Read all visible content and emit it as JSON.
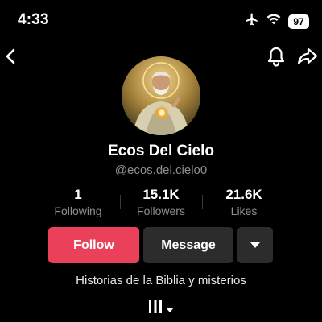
{
  "status_bar": {
    "time": "4:33",
    "battery": "97",
    "icons": [
      "airplane-icon",
      "wifi-icon",
      "battery-icon"
    ]
  },
  "nav": {
    "icons": [
      "back-chevron-icon",
      "bell-icon",
      "share-arrow-icon"
    ]
  },
  "profile": {
    "display_name": "Ecos Del Cielo",
    "username": "@ecos.del.cielo0",
    "bio": "Historias de la Biblia y misterios"
  },
  "stats": [
    {
      "value": "1",
      "label": "Following"
    },
    {
      "value": "15.1K",
      "label": "Followers"
    },
    {
      "value": "21.6K",
      "label": "Likes"
    }
  ],
  "actions": {
    "follow_label": "Follow",
    "message_label": "Message",
    "more_icon": "caret-down-icon"
  },
  "tabs": {
    "icon": "grid-columns-icon"
  },
  "colors": {
    "background": "#000000",
    "follow_button": "#ea4059",
    "secondary_button": "#2c2c2c",
    "muted_text": "#8e8e8e"
  }
}
